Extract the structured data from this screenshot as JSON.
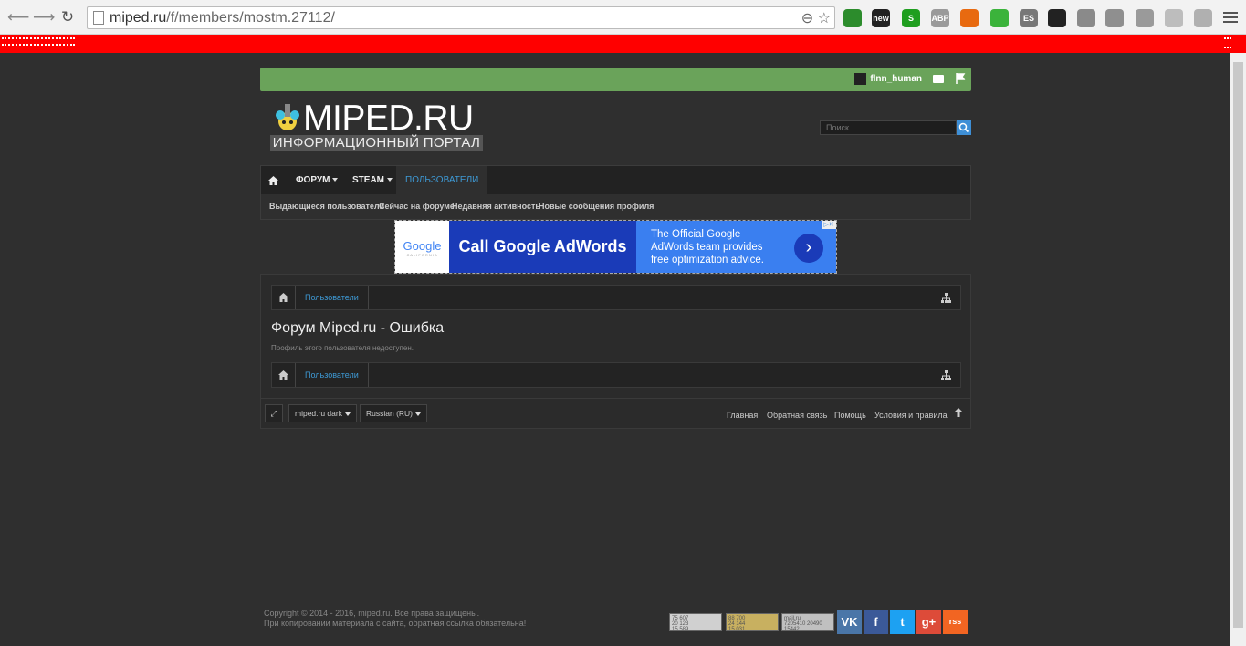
{
  "browser": {
    "url_host": "miped.ru",
    "url_path": "/f/members/mostm.27112/",
    "back_glyph": "⟵",
    "forward_glyph": "⟶",
    "reload_glyph": "↻",
    "zoom_glyph": "⊖",
    "star_glyph": "☆",
    "extensions": [
      {
        "name": "green-circle-extension",
        "label": "",
        "color": "#2c8c2c"
      },
      {
        "name": "mail-new-extension",
        "label": "new",
        "color": "#222222"
      },
      {
        "name": "green-s-extension",
        "label": "S",
        "color": "#1f9e1f"
      },
      {
        "name": "adblock-plus-extension",
        "label": "ABP",
        "color": "#9a9a9a"
      },
      {
        "name": "fire-extension",
        "label": "",
        "color": "#e86a10"
      },
      {
        "name": "clover-extension",
        "label": "",
        "color": "#3bb33b"
      },
      {
        "name": "es-extension",
        "label": "ES",
        "color": "#777777"
      },
      {
        "name": "sunglasses-extension",
        "label": "",
        "color": "#222222"
      },
      {
        "name": "gray-extension-1",
        "label": "",
        "color": "#8a8a8a"
      },
      {
        "name": "gray-extension-2",
        "label": "",
        "color": "#8f8f8f"
      },
      {
        "name": "gray-extension-3",
        "label": "",
        "color": "#9a9a9a"
      },
      {
        "name": "gray-extension-4",
        "label": "",
        "color": "#bdbdbd"
      },
      {
        "name": "gray-extension-5",
        "label": "",
        "color": "#b0b0b0"
      }
    ]
  },
  "forum": {
    "username": "flnn_human",
    "logo_main": "MIPED.RU",
    "logo_sub": "ИНФОРМАЦИОННЫЙ ПОРТАЛ",
    "search_placeholder": "Поиск...",
    "tabs": [
      {
        "label": "ФОРУМ",
        "has_caret": true
      },
      {
        "label": "STEAM",
        "has_caret": true
      },
      {
        "label": "ПОЛЬЗОВАТЕЛИ",
        "active": true
      }
    ],
    "subnav": [
      "Выдающиеся пользователи",
      "Сейчас на форуме",
      "Недавняя активность",
      "Новые сообщения профиля"
    ],
    "ad": {
      "logo_text": "Google",
      "logo_sub": "CALIFORNIA",
      "cta": "Call Google AdWords",
      "body": "The Official Google AdWords team provides free optimization advice.",
      "arrow": "›"
    },
    "breadcrumb": "Пользователи",
    "page_title": "Форум Miped.ru - Ошибка",
    "error_text": "Профиль этого пользователя недоступен.",
    "style_chooser": "miped.ru dark",
    "language_chooser": "Russian (RU)",
    "footer_links": [
      "Главная",
      "Обратная связь",
      "Помощь",
      "Условия и правила"
    ],
    "copyright_line1": "Copyright © 2014 - 2016, miped.ru. Все права защищены.",
    "copyright_line2": "При копировании материала с сайта, обратная ссылка обязательна!",
    "counters": [
      {
        "text": "75 607\n20 123\n15 589",
        "color": "#d0d0d0"
      },
      {
        "text": "88 700\n24 144\n15 031",
        "color": "#c8b060"
      },
      {
        "text": "mail.ru\n7205410 20490\n15442",
        "color": "#c0c0c0"
      }
    ],
    "social": [
      {
        "name": "vk-button",
        "label": "VK",
        "color": "#4a76a8"
      },
      {
        "name": "facebook-button",
        "label": "f",
        "color": "#3b5998"
      },
      {
        "name": "twitter-button",
        "label": "t",
        "color": "#1da1f2"
      },
      {
        "name": "google-plus-button",
        "label": "g+",
        "color": "#dd4b39"
      },
      {
        "name": "rss-button",
        "label": "rss",
        "color": "#f26522"
      }
    ]
  }
}
